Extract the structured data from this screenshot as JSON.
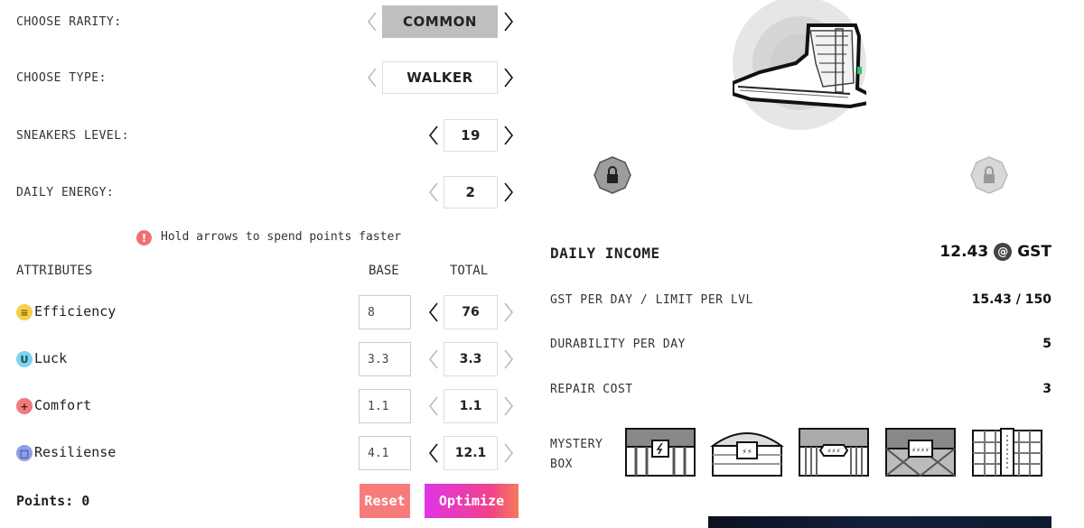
{
  "left": {
    "rarity": {
      "label": "CHOOSE RARITY:",
      "value": "COMMON"
    },
    "type": {
      "label": "CHOOSE TYPE:",
      "value": "WALKER"
    },
    "level": {
      "label": "SNEAKERS LEVEL:",
      "value": "19"
    },
    "energy": {
      "label": "DAILY ENERGY:",
      "value": "2"
    },
    "hint": "Hold arrows to spend points faster",
    "attributes_header": {
      "title": "ATTRIBUTES",
      "base": "BASE",
      "total": "TOTAL"
    },
    "attributes": [
      {
        "name": "Efficiency",
        "base": "8",
        "total": "76",
        "icon": "efficiency-icon",
        "color": "#f5d04a"
      },
      {
        "name": "Luck",
        "base": "3.3",
        "total": "3.3",
        "icon": "luck-icon",
        "color": "#7fd3ef"
      },
      {
        "name": "Comfort",
        "base": "1.1",
        "total": "1.1",
        "icon": "comfort-icon",
        "color": "#f07b7b"
      },
      {
        "name": "Resiliense",
        "base": "4.1",
        "total": "12.1",
        "icon": "resilience-icon",
        "color": "#8f9ee8"
      }
    ],
    "points": "Points: 0",
    "reset_label": "Reset",
    "optimize_label": "Optimize",
    "colors": {
      "reset": "#f77b7b",
      "optimize_from": "#e035e6",
      "optimize_to": "#f56c8f"
    }
  },
  "right": {
    "daily_income": {
      "label": "DAILY INCOME",
      "value": "12.43",
      "unit": "GST"
    },
    "rows": [
      {
        "label": "GST PER DAY / LIMIT PER LVL",
        "value": "15.43 / 150"
      },
      {
        "label": "DURABILITY PER DAY",
        "value": "5"
      },
      {
        "label": "REPAIR COST",
        "value": "3"
      }
    ],
    "mystery_box_label_1": "MYSTERY",
    "mystery_box_label_2": "BOX"
  }
}
